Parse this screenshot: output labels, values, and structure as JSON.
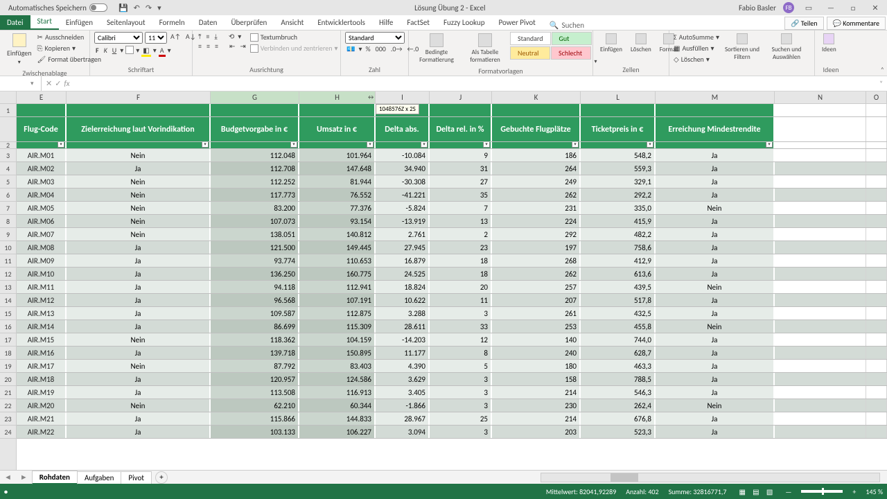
{
  "titlebar": {
    "autosave": "Automatisches Speichern",
    "doc": "Lösung Übung 2  -  Excel",
    "user": "Fabio Basler",
    "avatar": "FB"
  },
  "tabs": {
    "datei": "Datei",
    "start": "Start",
    "einfuegen": "Einfügen",
    "seitenlayout": "Seitenlayout",
    "formeln": "Formeln",
    "daten": "Daten",
    "ueberpruefen": "Überprüfen",
    "ansicht": "Ansicht",
    "entwickler": "Entwicklertools",
    "hilfe": "Hilfe",
    "factset": "FactSet",
    "fuzzy": "Fuzzy Lookup",
    "powerpivot": "Power Pivot",
    "suchen": "Suchen",
    "teilen": "Teilen",
    "kommentare": "Kommentare"
  },
  "ribbon": {
    "einfuegen": "Einfügen",
    "ausschneiden": "Ausschneiden",
    "kopieren": "Kopieren",
    "format_uebertragen": "Format übertragen",
    "zwischenablage": "Zwischenablage",
    "fontname": "Calibri",
    "fontsize": "11",
    "schriftart": "Schriftart",
    "textumbruch": "Textumbruch",
    "verbinden": "Verbinden und zentrieren",
    "ausrichtung": "Ausrichtung",
    "zahlformat": "Standard",
    "zahl": "Zahl",
    "bedingte": "Bedingte Formatierung",
    "als_tabelle": "Als Tabelle formatieren",
    "standard": "Standard",
    "gut": "Gut",
    "neutral": "Neutral",
    "schlecht": "Schlecht",
    "formatvorlagen": "Formatvorlagen",
    "zellen_einfuegen": "Einfügen",
    "loeschen": "Löschen",
    "format": "Format",
    "zellen": "Zellen",
    "autosumme": "AutoSumme",
    "ausfuellen": "Ausfüllen",
    "loeschen2": "Löschen",
    "sortieren": "Sortieren und Filtern",
    "suchen_und": "Suchen und Auswählen",
    "ideen": "Ideen"
  },
  "namebox": "",
  "selection_tip": "1048576Z x 2S",
  "columns": [
    "E",
    "F",
    "G",
    "H",
    "I",
    "J",
    "K",
    "L",
    "M",
    "N",
    "O"
  ],
  "headers": {
    "E": "Flug-Code",
    "F": "Zielerreichung laut Vorindikation",
    "G": "Budgetvorgabe in €",
    "H": "Umsatz in €",
    "I": "Delta abs.",
    "J": "Delta rel. in %",
    "K": "Gebuchte Flugplätze",
    "L": "Ticketpreis in €",
    "M": "Erreichung Mindestrendite"
  },
  "rows": [
    [
      "AIR.M01",
      "Nein",
      "112.048",
      "101.964",
      "-10.084",
      "9",
      "186",
      "548,2",
      "Ja"
    ],
    [
      "AIR.M02",
      "Ja",
      "112.708",
      "147.648",
      "34.940",
      "31",
      "264",
      "559,3",
      "Ja"
    ],
    [
      "AIR.M03",
      "Nein",
      "112.252",
      "81.944",
      "-30.308",
      "27",
      "249",
      "329,1",
      "Ja"
    ],
    [
      "AIR.M04",
      "Nein",
      "117.773",
      "76.552",
      "-41.221",
      "35",
      "262",
      "292,2",
      "Ja"
    ],
    [
      "AIR.M05",
      "Nein",
      "83.200",
      "77.376",
      "-5.824",
      "7",
      "231",
      "335,0",
      "Nein"
    ],
    [
      "AIR.M06",
      "Nein",
      "107.073",
      "93.154",
      "-13.919",
      "13",
      "224",
      "415,9",
      "Ja"
    ],
    [
      "AIR.M07",
      "Nein",
      "138.051",
      "140.812",
      "2.761",
      "2",
      "292",
      "482,2",
      "Ja"
    ],
    [
      "AIR.M08",
      "Ja",
      "121.500",
      "149.445",
      "27.945",
      "23",
      "197",
      "758,6",
      "Ja"
    ],
    [
      "AIR.M09",
      "Ja",
      "93.774",
      "110.653",
      "16.879",
      "18",
      "268",
      "412,9",
      "Ja"
    ],
    [
      "AIR.M10",
      "Ja",
      "136.250",
      "160.775",
      "24.525",
      "18",
      "262",
      "613,6",
      "Ja"
    ],
    [
      "AIR.M11",
      "Ja",
      "94.118",
      "112.941",
      "18.824",
      "20",
      "257",
      "439,5",
      "Nein"
    ],
    [
      "AIR.M12",
      "Ja",
      "96.568",
      "107.191",
      "10.622",
      "11",
      "207",
      "517,8",
      "Ja"
    ],
    [
      "AIR.M13",
      "Ja",
      "109.587",
      "112.875",
      "3.288",
      "3",
      "261",
      "432,5",
      "Ja"
    ],
    [
      "AIR.M14",
      "Ja",
      "86.699",
      "115.309",
      "28.611",
      "33",
      "253",
      "455,8",
      "Nein"
    ],
    [
      "AIR.M15",
      "Nein",
      "118.362",
      "104.159",
      "-14.203",
      "12",
      "140",
      "744,0",
      "Ja"
    ],
    [
      "AIR.M16",
      "Ja",
      "139.718",
      "150.895",
      "11.177",
      "8",
      "240",
      "628,7",
      "Ja"
    ],
    [
      "AIR.M17",
      "Nein",
      "87.792",
      "83.403",
      "4.390",
      "5",
      "180",
      "463,3",
      "Ja"
    ],
    [
      "AIR.M18",
      "Ja",
      "120.957",
      "124.586",
      "3.629",
      "3",
      "158",
      "788,5",
      "Ja"
    ],
    [
      "AIR.M19",
      "Ja",
      "113.508",
      "116.913",
      "3.405",
      "3",
      "214",
      "546,3",
      "Ja"
    ],
    [
      "AIR.M20",
      "Nein",
      "62.210",
      "60.344",
      "-1.866",
      "3",
      "230",
      "262,4",
      "Nein"
    ],
    [
      "AIR.M21",
      "Ja",
      "115.866",
      "144.833",
      "28.967",
      "25",
      "214",
      "676,8",
      "Ja"
    ],
    [
      "AIR.M22",
      "Ja",
      "103.133",
      "106.227",
      "3.094",
      "3",
      "203",
      "523,3",
      "Ja"
    ]
  ],
  "sheets": {
    "rohdaten": "Rohdaten",
    "aufgaben": "Aufgaben",
    "pivot": "Pivot"
  },
  "status": {
    "mittelwert": "Mittelwert: 82041,92289",
    "anzahl": "Anzahl: 402",
    "summe": "Summe: 32816771,7",
    "zoom": "145 %"
  }
}
